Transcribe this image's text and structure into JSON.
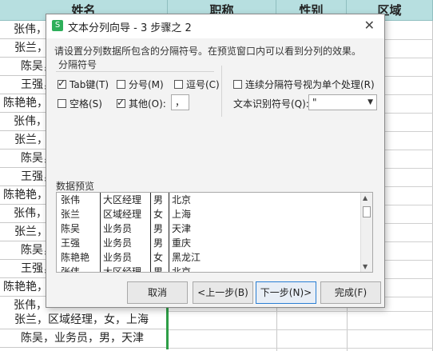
{
  "sheet": {
    "headers": [
      "姓名",
      "职称",
      "性别",
      "区域"
    ],
    "rows": [
      "张伟，",
      "张兰，",
      "陈吴，",
      "王强，",
      "陈艳艳，",
      "张伟，",
      "张兰，",
      "陈吴，",
      "王强，",
      "陈艳艳，",
      "张伟，",
      "张兰，",
      "陈吴，",
      "王强，",
      "陈艳艳，",
      "张伟，",
      "张兰，区域经理，女，上海",
      "陈吴，业务员，男，天津"
    ]
  },
  "dialog": {
    "title": "文本分列向导 - 3 步骤之 2",
    "close": "✕",
    "description": "请设置分列数据所包含的分隔符号。在预览窗口内可以看到分列的效果。",
    "group_label": "分隔符号",
    "options": {
      "tab": {
        "label": "Tab键(T)",
        "checked": true
      },
      "semicolon": {
        "label": "分号(M)",
        "checked": false
      },
      "comma": {
        "label": "逗号(C)",
        "checked": false
      },
      "space": {
        "label": "空格(S)",
        "checked": false
      },
      "other": {
        "label": "其他(O):",
        "checked": true
      },
      "consecutive": {
        "label": "连续分隔符号视为单个处理(R)",
        "checked": false
      }
    },
    "other_value": "，",
    "qualifier_label": "文本识别符号(Q):",
    "qualifier_value": "\"",
    "preview_label": "数据预览",
    "preview_rows": [
      [
        "张伟",
        "大区经理",
        "男",
        "北京"
      ],
      [
        "张兰",
        "区域经理",
        "女",
        "上海"
      ],
      [
        "陈吴",
        "业务员",
        "男",
        "天津"
      ],
      [
        "王强",
        "业务员",
        "男",
        "重庆"
      ],
      [
        "陈艳艳",
        "业务员",
        "女",
        "黑龙江"
      ],
      [
        "张伟",
        "大区经理",
        "男",
        "北京"
      ]
    ],
    "buttons": {
      "cancel": "取消",
      "back": "<上一步(B)",
      "next": "下一步(N)>",
      "finish": "完成(F)"
    }
  }
}
